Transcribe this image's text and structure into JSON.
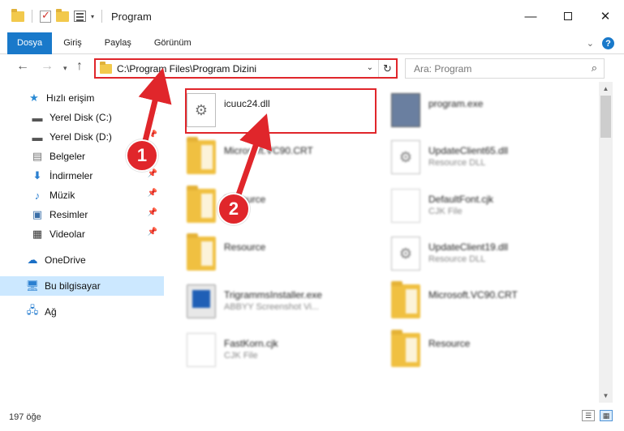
{
  "window": {
    "title": "Program"
  },
  "ribbon": {
    "tabs": [
      "Dosya",
      "Giriş",
      "Paylaş",
      "Görünüm"
    ]
  },
  "address": {
    "path": "C:\\Program Files\\Program Dizini"
  },
  "search": {
    "placeholder": "Ara: Program"
  },
  "sidebar": {
    "items": [
      {
        "label": "Hızlı erişim",
        "icon": "star-icon"
      },
      {
        "label": "Yerel Disk (C:)",
        "icon": "drive-icon"
      },
      {
        "label": "Yerel Disk (D:)",
        "icon": "drive-icon"
      },
      {
        "label": "Belgeler",
        "icon": "document-icon"
      },
      {
        "label": "İndirmeler",
        "icon": "download-icon"
      },
      {
        "label": "Müzik",
        "icon": "music-icon"
      },
      {
        "label": "Resimler",
        "icon": "picture-icon"
      },
      {
        "label": "Videolar",
        "icon": "video-icon"
      },
      {
        "label": "OneDrive",
        "icon": "cloud-icon"
      },
      {
        "label": "Bu bilgisayar",
        "icon": "computer-icon"
      },
      {
        "label": "Ağ",
        "icon": "network-icon"
      }
    ]
  },
  "files": [
    {
      "name": "icuuc24.dll",
      "desc": "",
      "type": "dll"
    },
    {
      "name": "program.exe",
      "desc": "",
      "type": "exe"
    },
    {
      "name": "Microsoft.VC90.CRT",
      "desc": "",
      "type": "folder"
    },
    {
      "name": "UpdateClient65.dll",
      "desc": "Resource DLL",
      "type": "dll"
    },
    {
      "name": "Resource",
      "desc": "",
      "type": "folder"
    },
    {
      "name": "DefaultFont.cjk",
      "desc": "CJK File",
      "type": "page"
    },
    {
      "name": "Resource",
      "desc": "",
      "type": "folder"
    },
    {
      "name": "UpdateClient19.dll",
      "desc": "Resource DLL",
      "type": "dll"
    },
    {
      "name": "TrigrammsInstaller.exe",
      "desc": "ABBYY Screenshot Vi...",
      "type": "app"
    },
    {
      "name": "Microsoft.VC90.CRT",
      "desc": "",
      "type": "folder"
    },
    {
      "name": "FastKorn.cjk",
      "desc": "CJK File",
      "type": "page"
    },
    {
      "name": "Resource",
      "desc": "",
      "type": "folder"
    }
  ],
  "status": {
    "count": "197 öğe"
  },
  "annotations": {
    "step1": "1",
    "step2": "2"
  },
  "colors": {
    "accent": "#1979ca",
    "highlight": "#e0262b",
    "selection": "#cce8ff"
  }
}
